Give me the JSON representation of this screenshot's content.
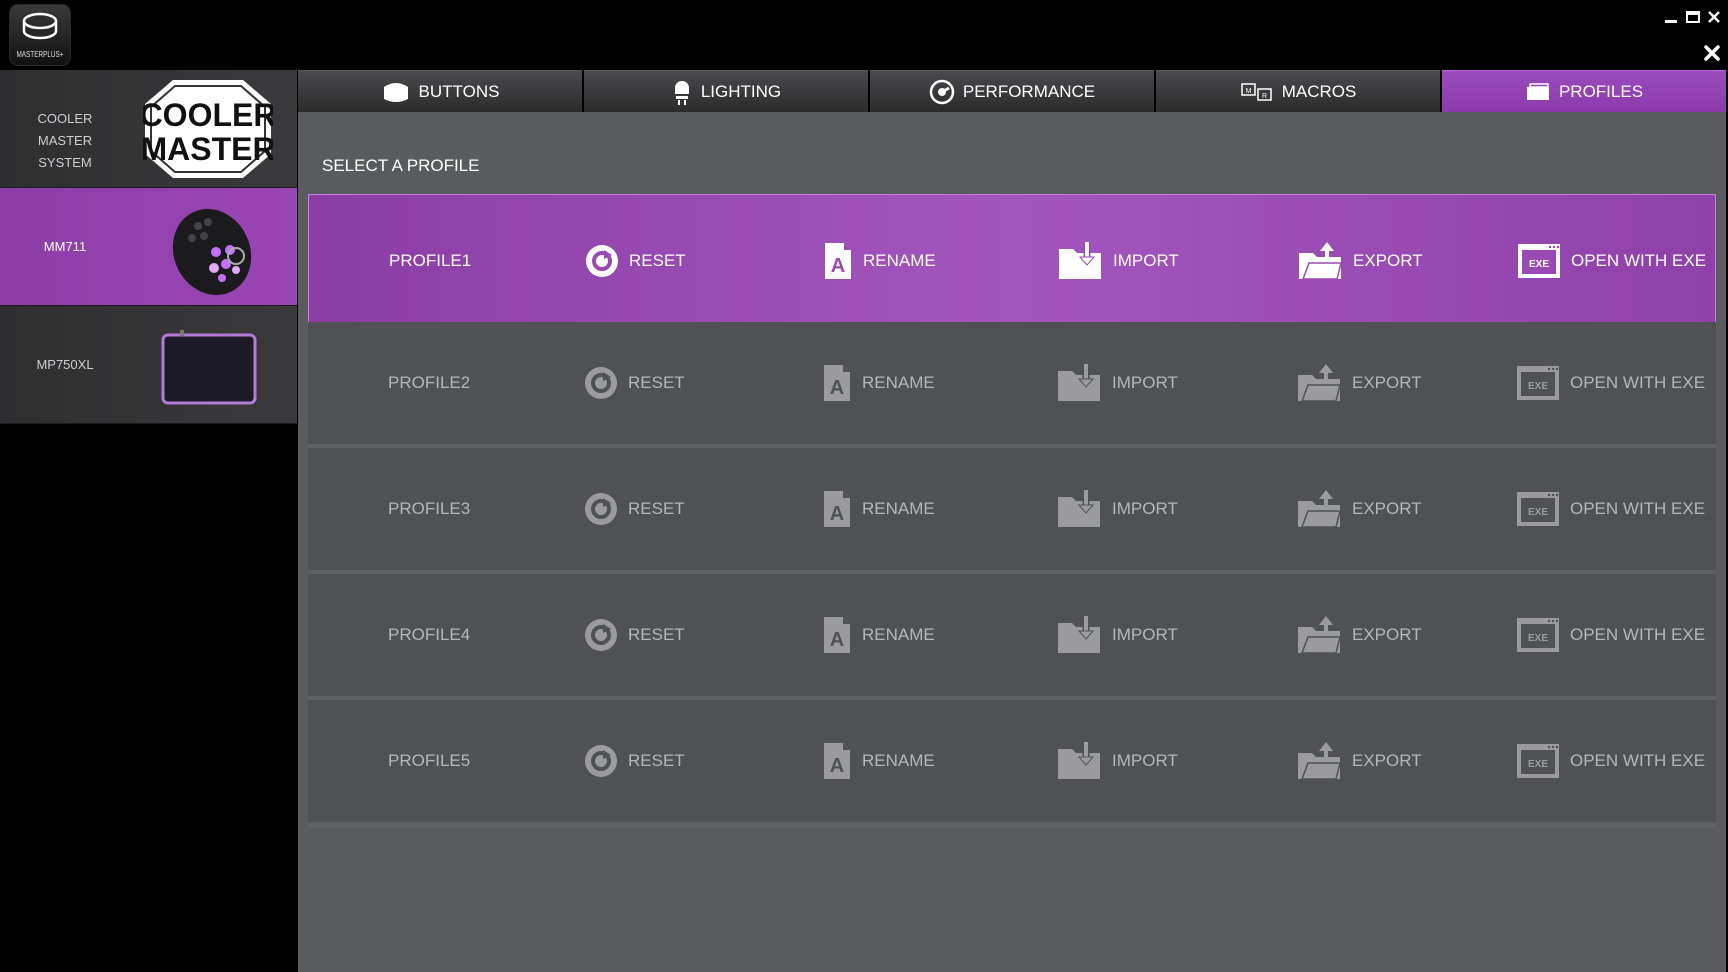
{
  "app": {
    "logo_text": "MASTERPLUS+"
  },
  "sidebar": {
    "items": [
      {
        "label": "COOLER MASTER SYSTEM",
        "active": false
      },
      {
        "label": "MM711",
        "active": true
      },
      {
        "label": "MP750XL",
        "active": false
      }
    ],
    "brand_text": "COOLER MASTER"
  },
  "tabs": [
    {
      "label": "BUTTONS",
      "icon": "mouse-icon",
      "active": false
    },
    {
      "label": "LIGHTING",
      "icon": "lightbulb-icon",
      "active": false
    },
    {
      "label": "PERFORMANCE",
      "icon": "speedometer-icon",
      "active": false
    },
    {
      "label": "MACROS",
      "icon": "macro-keys-icon",
      "active": false
    },
    {
      "label": "PROFILES",
      "icon": "profile-card-icon",
      "active": true
    }
  ],
  "main": {
    "title": "SELECT A PROFILE",
    "profiles": [
      {
        "name": "PROFILE1",
        "active": true
      },
      {
        "name": "PROFILE2",
        "active": false
      },
      {
        "name": "PROFILE3",
        "active": false
      },
      {
        "name": "PROFILE4",
        "active": false
      },
      {
        "name": "PROFILE5",
        "active": false
      }
    ],
    "actions": {
      "reset": "RESET",
      "rename": "RENAME",
      "import": "IMPORT",
      "export": "EXPORT",
      "exe": "OPEN WITH EXE",
      "exe_badge": "EXE",
      "rename_glyph": "A"
    }
  },
  "colors": {
    "accent": "#9b4cbc",
    "panel": "#5a5b5e",
    "row": "#505154"
  }
}
